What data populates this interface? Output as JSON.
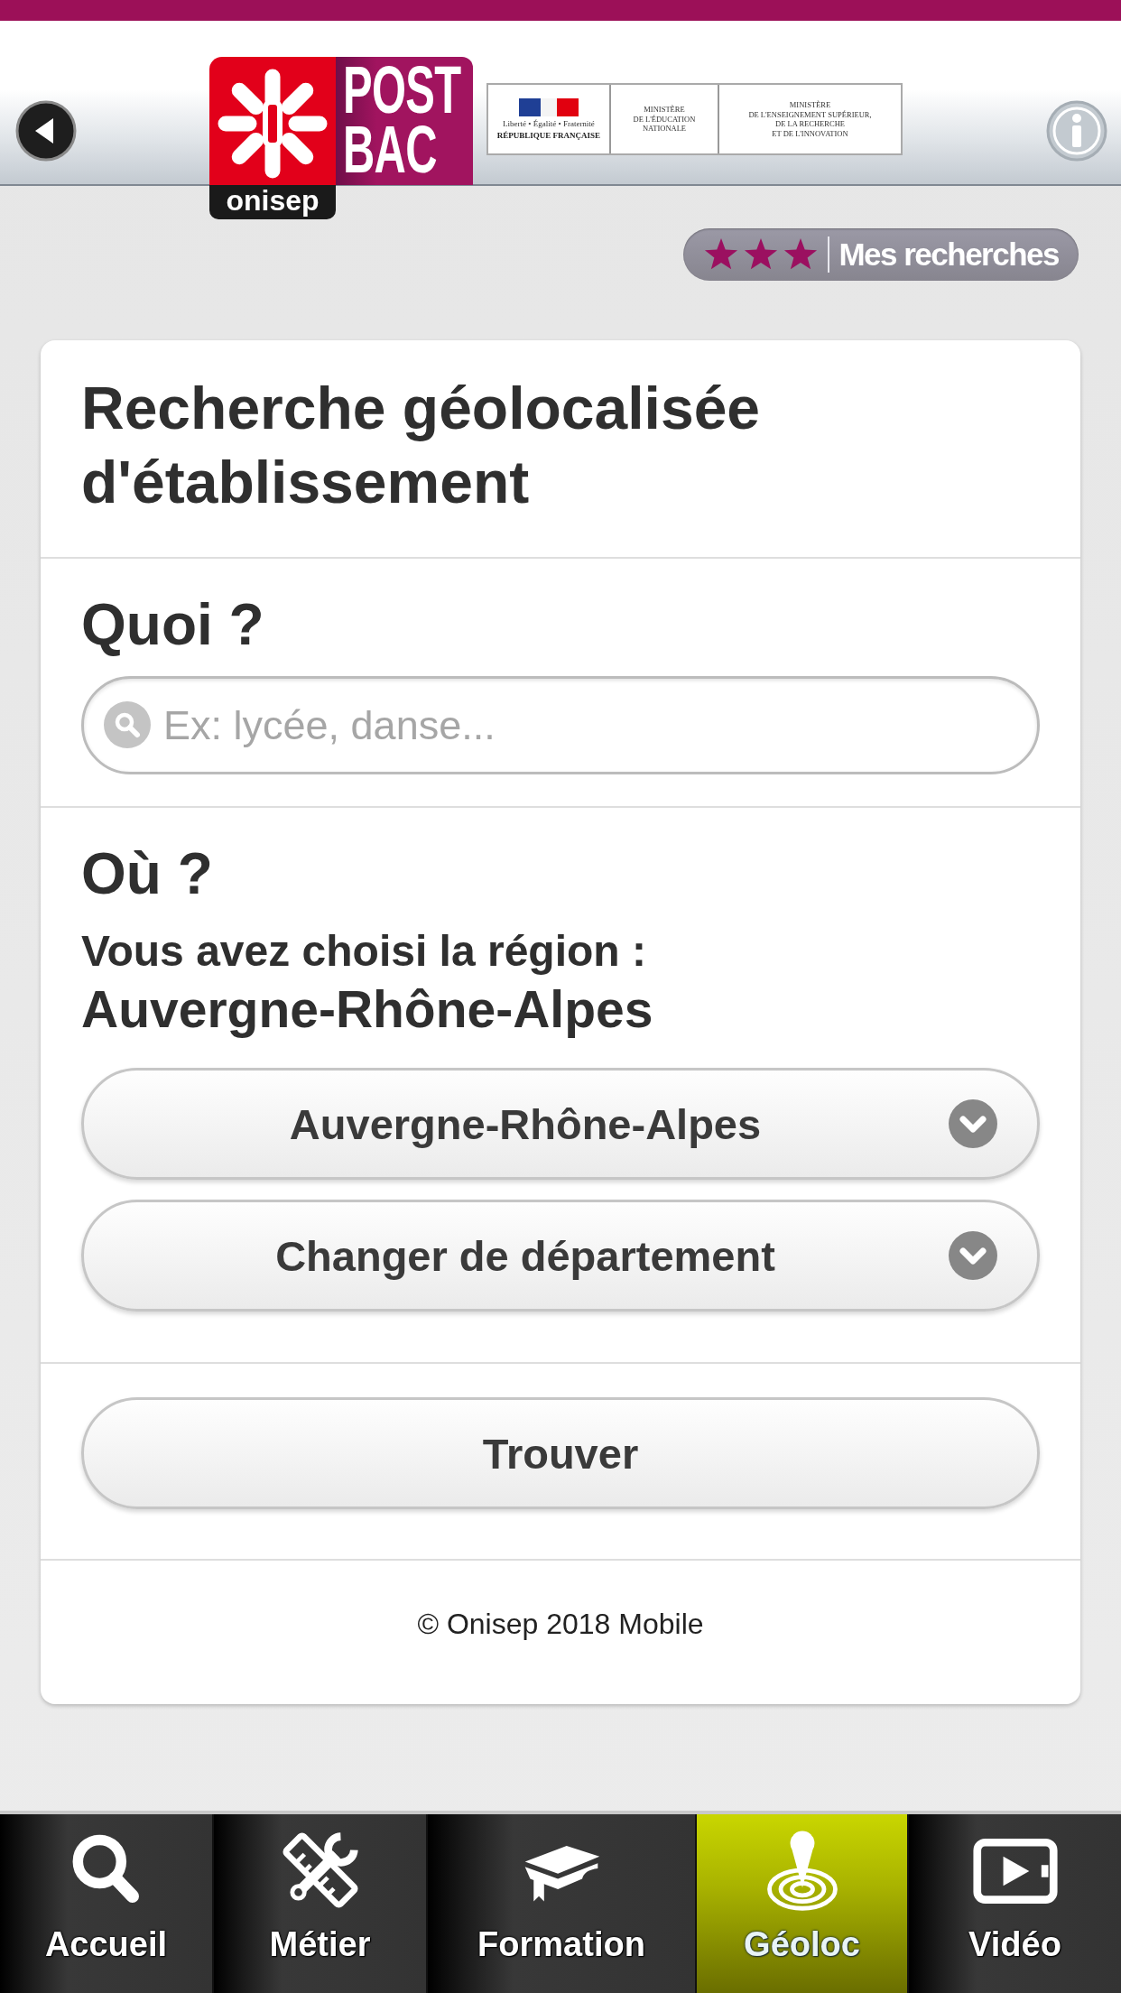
{
  "header": {
    "logo": {
      "wordmark": "POST BAC",
      "tagline": "onisep"
    },
    "republic": {
      "motto": "Liberté • Égalité • Fraternité",
      "name": "RÉPUBLIQUE FRANÇAISE"
    },
    "ministries": [
      {
        "lines": [
          "MINISTÈRE",
          "DE L'ÉDUCATION",
          "NATIONALE"
        ]
      },
      {
        "lines": [
          "MINISTÈRE",
          "DE L'ENSEIGNEMENT SUPÉRIEUR,",
          "DE LA RECHERCHE",
          "ET DE L'INNOVATION"
        ]
      }
    ]
  },
  "saved_searches": {
    "label": "Mes recherches",
    "stars": 3
  },
  "card": {
    "title": "Recherche géolocalisée d'établissement",
    "what": {
      "heading": "Quoi ?",
      "search": {
        "placeholder": "Ex: lycée, danse..."
      }
    },
    "where": {
      "heading": "Où ?",
      "chosen_label": "Vous avez choisi la région :",
      "chosen_value": "Auvergne-Rhône-Alpes",
      "selects": [
        {
          "value": "Auvergne-Rhône-Alpes"
        },
        {
          "value": "Changer de département"
        }
      ]
    },
    "submit": "Trouver",
    "footer": "© Onisep 2018 Mobile"
  },
  "tabs": [
    {
      "label": "Accueil",
      "kind": "search",
      "selected": false
    },
    {
      "label": "Métier",
      "kind": "tools",
      "selected": false
    },
    {
      "label": "Formation",
      "kind": "book",
      "selected": false
    },
    {
      "label": "Géoloc",
      "kind": "location",
      "selected": true
    },
    {
      "label": "Vidéo",
      "kind": "video",
      "selected": false
    }
  ]
}
